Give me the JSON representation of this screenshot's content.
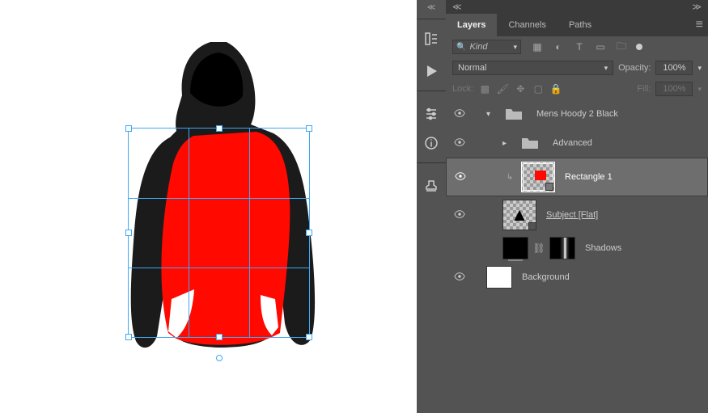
{
  "tabs": {
    "layers": "Layers",
    "channels": "Channels",
    "paths": "Paths"
  },
  "filter": {
    "label": "Kind"
  },
  "blend": {
    "mode": "Normal",
    "opacity_label": "Opacity:",
    "opacity": "100%"
  },
  "lock": {
    "label": "Lock:",
    "fill_label": "Fill:",
    "fill": "100%"
  },
  "layers_list": {
    "group": "Mens Hoody 2 Black",
    "advanced": "Advanced",
    "rect": "Rectangle 1",
    "subject": "Subject [Flat]",
    "shadows": "Shadows",
    "background": "Background"
  },
  "icons": {
    "expand_l": "≪",
    "expand_r": "≫"
  }
}
